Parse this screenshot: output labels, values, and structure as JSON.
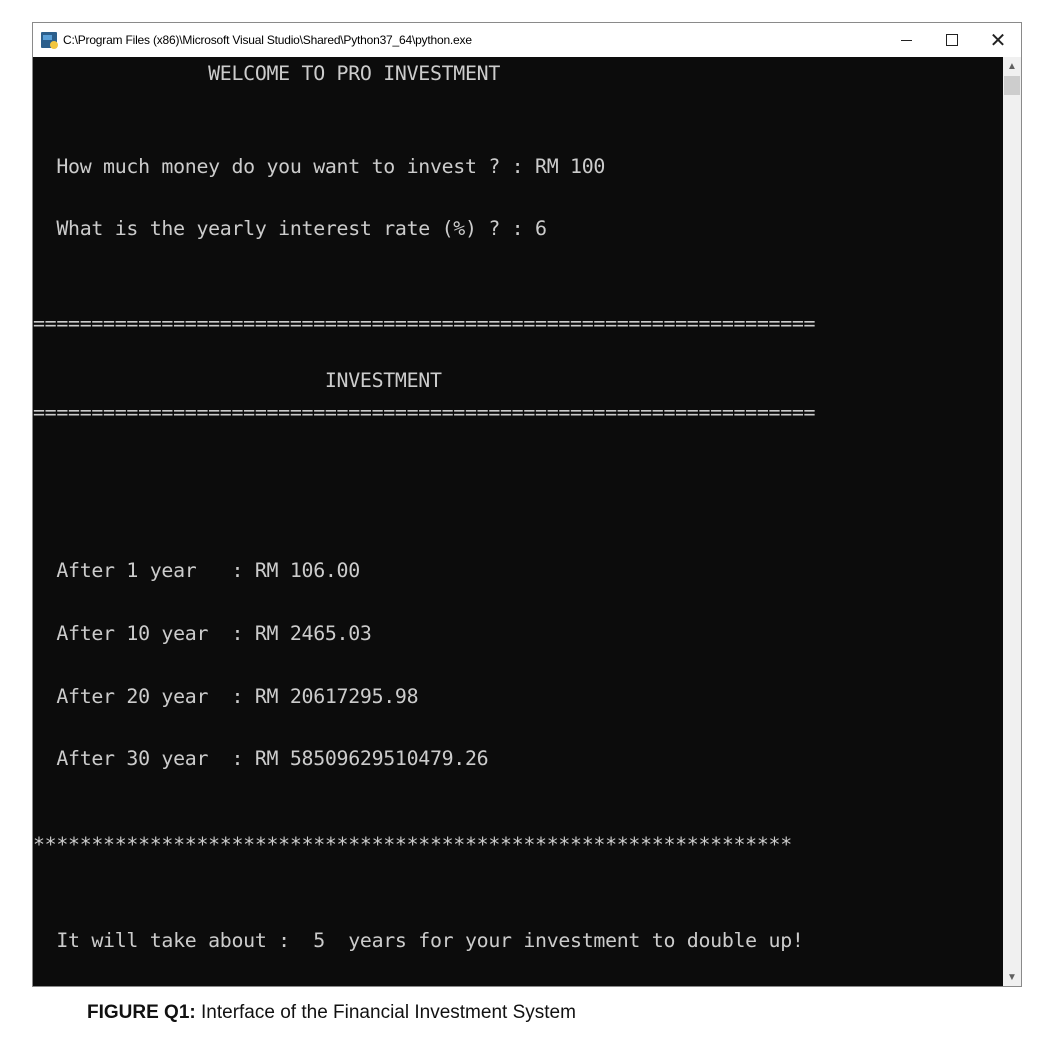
{
  "window": {
    "title": "C:\\Program Files (x86)\\Microsoft Visual Studio\\Shared\\Python37_64\\python.exe",
    "controls": {
      "minimize": "minimize",
      "maximize": "maximize",
      "close": "close"
    }
  },
  "console": {
    "welcome": "               WELCOME TO PRO INVESTMENT",
    "prompt_amount": "  How much money do you want to invest ? : RM 100",
    "prompt_rate": "  What is the yearly interest rate (%) ? : 6",
    "separator_eq": "===================================================================",
    "section_title": "                         INVESTMENT",
    "results": [
      {
        "text": "  After 1 year   : RM 106.00",
        "years": 1,
        "amount": "106.00"
      },
      {
        "text": "  After 10 year  : RM 2465.03",
        "years": 10,
        "amount": "2465.03"
      },
      {
        "text": "  After 20 year  : RM 20617295.98",
        "years": 20,
        "amount": "20617295.98"
      },
      {
        "text": "  After 30 year  : RM 58509629510479.26",
        "years": 30,
        "amount": "58509629510479.26"
      }
    ],
    "separator_star": "*****************************************************************",
    "doubling": "  It will take about :  5  years for your investment to double up!",
    "inputs": {
      "amount": "RM 100",
      "rate_percent": "6"
    },
    "doubling_years": "5"
  },
  "caption": {
    "label": "FIGURE Q1:",
    "text": " Interface of the Financial Investment System"
  }
}
